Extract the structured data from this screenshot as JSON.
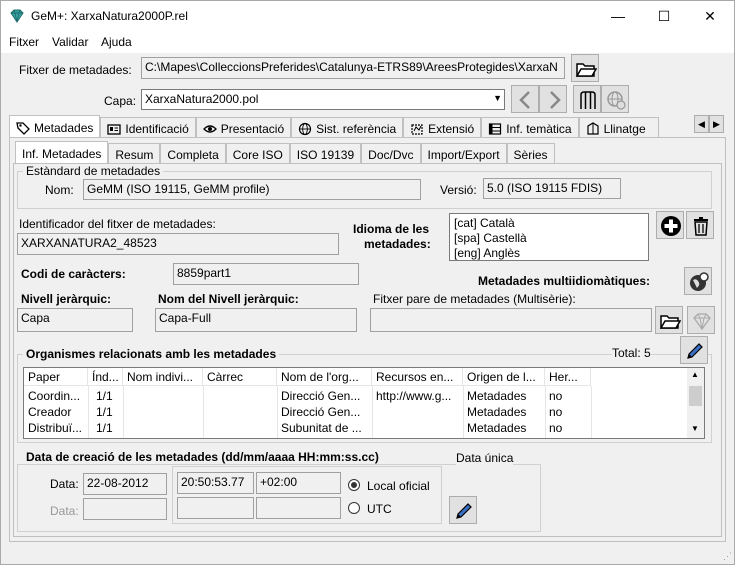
{
  "window": {
    "title": "GeM+: XarxaNatura2000P.rel",
    "minimize": "—",
    "maximize": "☐",
    "close": "✕"
  },
  "menu": [
    "Fitxer",
    "Validar",
    "Ajuda"
  ],
  "top": {
    "metadata_file_label": "Fitxer de metadades:",
    "metadata_file_value": "C:\\Mapes\\ColleccionsPreferides\\Catalunya-ETRS89\\AreesProtegides\\XarxaN",
    "layer_label": "Capa:",
    "layer_value": "XarxaNatura2000.pol"
  },
  "main_tabs": [
    "Metadades",
    "Identificació",
    "Presentació",
    "Sist. referència",
    "Extensió",
    "Inf. temàtica",
    "Llinatge"
  ],
  "sub_tabs": [
    "Inf. Metadades",
    "Resum",
    "Completa",
    "Core ISO",
    "ISO 19139",
    "Doc/Dvc",
    "Import/Export",
    "Sèries"
  ],
  "standard": {
    "group_title": "Estàndard de metadades",
    "name_label": "Nom:",
    "name_value": "GeMM (ISO 19115, GeMM profile)",
    "version_label": "Versió:",
    "version_value": "5.0 (ISO 19115 FDIS)"
  },
  "identifier": {
    "label": "Identificador del fitxer de metadades:",
    "value": "XARXANATURA2_48523"
  },
  "language": {
    "label_line1": "Idioma de les",
    "label_line2": "metadades:",
    "items": [
      "[cat] Català",
      "[spa] Castellà",
      "[eng] Anglès"
    ]
  },
  "charset": {
    "label": "Codi de caràcters:",
    "value": "8859part1"
  },
  "multilang_label": "Metadades multiidiomàtiques:",
  "hierarchy": {
    "level_label": "Nivell jeràrquic:",
    "level_value": "Capa",
    "level_name_label": "Nom del Nivell jeràrquic:",
    "level_name_value": "Capa-Full",
    "parent_label": "Fitxer pare de metadades (Multisèrie):",
    "parent_value": ""
  },
  "organisms": {
    "group_title": "Organismes relacionats amb les metadades",
    "total": "Total: 5",
    "columns": [
      "Paper",
      "Índ...",
      "Nom indivi...",
      "Càrrec",
      "Nom de l'org...",
      "Recursos en...",
      "Origen de l...",
      "Her..."
    ],
    "rows": [
      [
        "Coordin...",
        "1/1",
        "",
        "",
        "Direcció Gen...",
        "http://www.g...",
        "Metadades",
        "no"
      ],
      [
        "Creador",
        "1/1",
        "",
        "",
        "Direcció Gen...",
        "",
        "Metadades",
        "no"
      ],
      [
        "Distribuï...",
        "1/1",
        "",
        "",
        "Subunitat de ...",
        "",
        "Metadades",
        "no"
      ]
    ]
  },
  "creation": {
    "group_title": "Data de creació de les metadades (dd/mm/aaaa HH:mm:ss.cc)",
    "unique_label": "Data única",
    "date_label": "Data:",
    "date_value": "22-08-2012",
    "date2_label": "Data:",
    "date2_value": "",
    "time_value": "20:50:53.77",
    "tz_value": "+02:00",
    "time2_value": "",
    "tz2_value": "",
    "radio_local": "Local oficial",
    "radio_utc": "UTC"
  }
}
